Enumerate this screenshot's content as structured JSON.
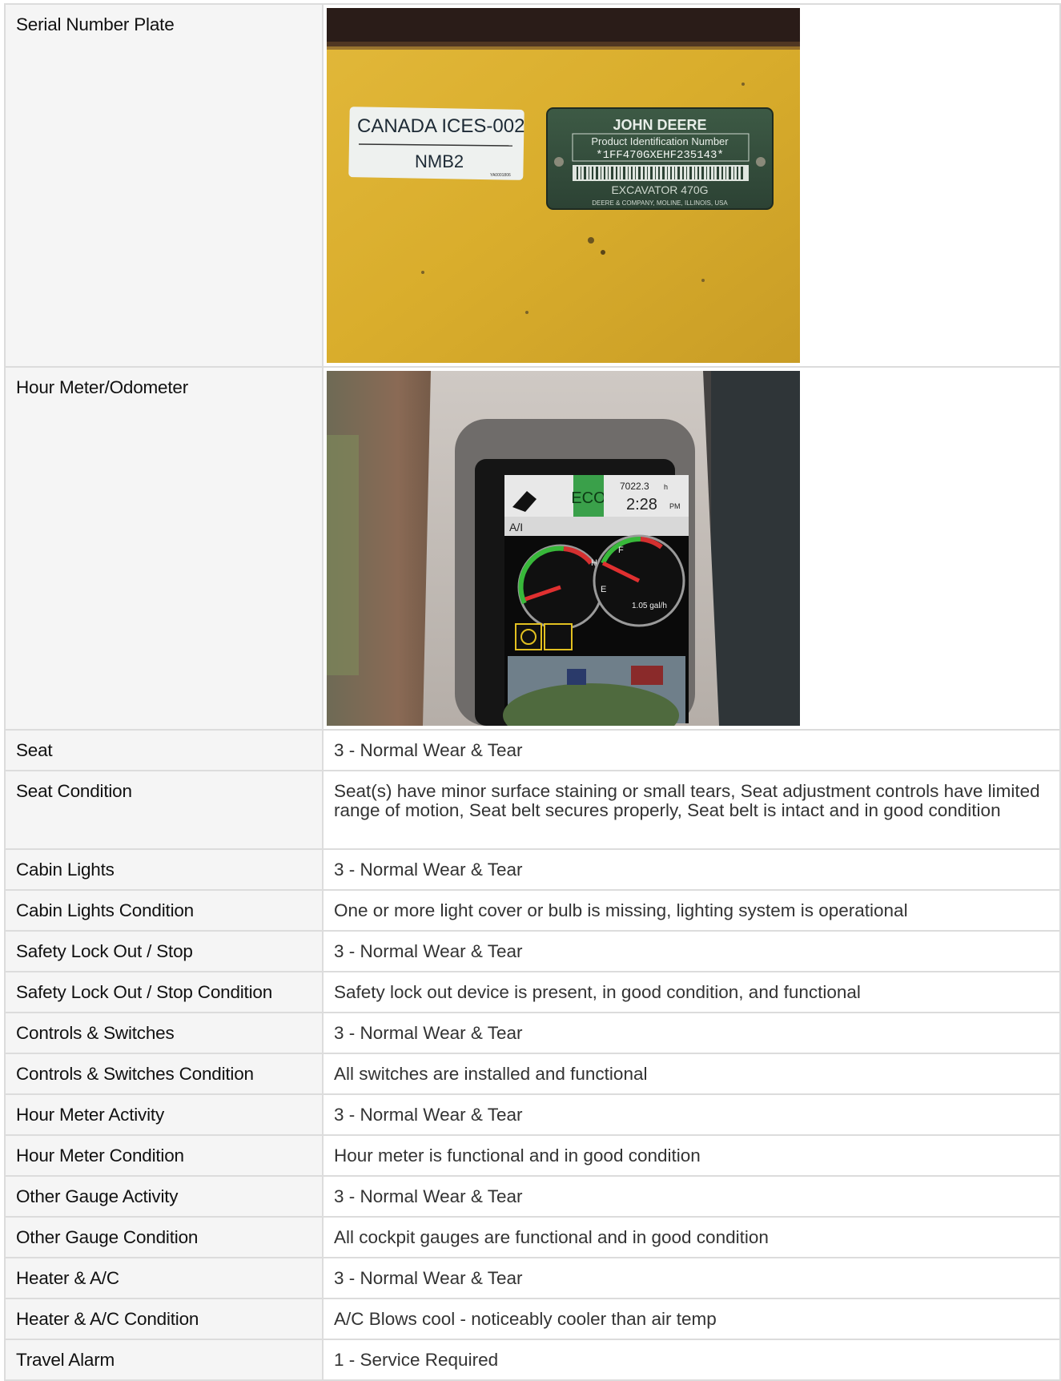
{
  "photos": [
    {
      "label": "Serial Number Plate",
      "sticker_line1": "CANADA  ICES-002",
      "sticker_line2": "NMB2",
      "sticker_code": "YA0001806",
      "plate_brand": "JOHN DEERE",
      "plate_title": "Product Identification Number",
      "plate_pin": "*1FF470GXEHF235143*",
      "plate_model": "EXCAVATOR 470G",
      "plate_maker": "DEERE & COMPANY, MOLINE, ILLINOIS, USA"
    },
    {
      "label": "Hour Meter/Odometer",
      "display_mode": "ECO",
      "display_hours": "7022.3",
      "display_hours_unit": "h",
      "display_time": "2:28",
      "display_ampm": "PM",
      "display_mode_left": "A/I",
      "display_fuel_rate": "1.05 gal/h",
      "gauge_h": "H",
      "gauge_f": "F",
      "gauge_e": "E"
    }
  ],
  "rows": [
    {
      "label": "Seat",
      "value": "3 - Normal Wear & Tear"
    },
    {
      "label": "Seat Condition",
      "value": "Seat(s) have minor surface staining or small tears, Seat adjustment controls have limited range of motion, Seat belt secures properly, Seat belt is intact and in good condition"
    },
    {
      "label": "Cabin Lights",
      "value": "3 - Normal Wear & Tear"
    },
    {
      "label": "Cabin Lights Condition",
      "value": "One or more light cover or bulb is missing, lighting system is operational"
    },
    {
      "label": "Safety Lock Out / Stop",
      "value": "3 - Normal Wear & Tear"
    },
    {
      "label": "Safety Lock Out / Stop Condition",
      "value": "Safety lock out device is present, in good condition, and functional"
    },
    {
      "label": "Controls & Switches",
      "value": "3 - Normal Wear & Tear"
    },
    {
      "label": "Controls & Switches Condition",
      "value": "All switches are installed and functional"
    },
    {
      "label": "Hour Meter Activity",
      "value": "3 - Normal Wear & Tear"
    },
    {
      "label": "Hour Meter Condition",
      "value": "Hour meter is functional and in good condition"
    },
    {
      "label": "Other Gauge Activity",
      "value": "3 - Normal Wear & Tear"
    },
    {
      "label": "Other Gauge Condition",
      "value": "All cockpit gauges are functional and in good condition"
    },
    {
      "label": "Heater & A/C",
      "value": "3 - Normal Wear & Tear"
    },
    {
      "label": "Heater & A/C Condition",
      "value": "A/C Blows cool - noticeably cooler than air temp"
    },
    {
      "label": "Travel Alarm",
      "value": "1 - Service Required"
    }
  ]
}
